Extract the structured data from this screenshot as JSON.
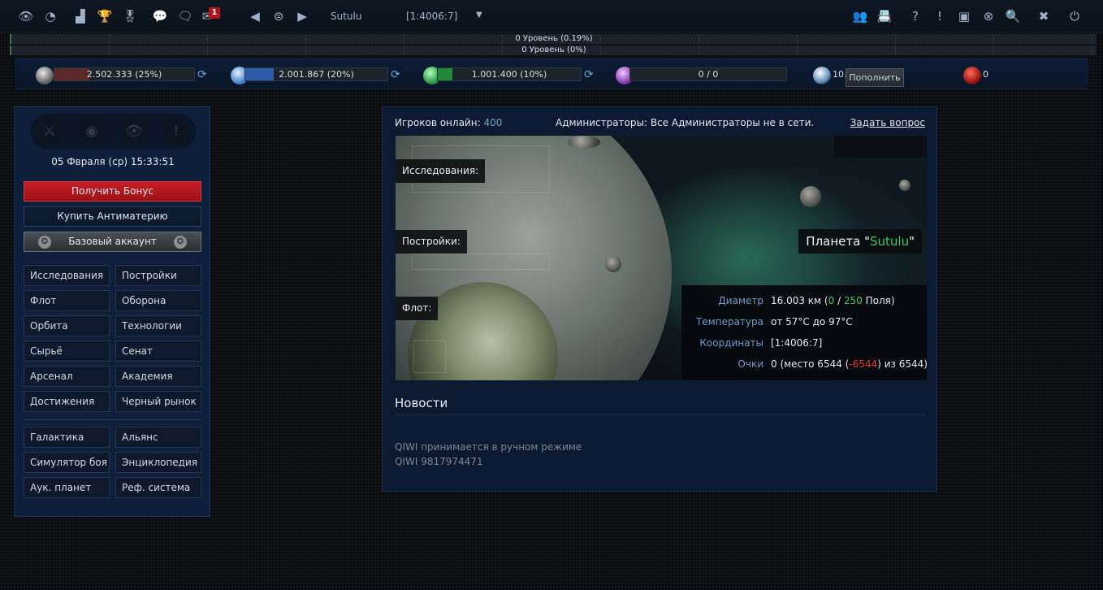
{
  "topbar": {
    "left_icons": [
      "eye-icon",
      "pie-chart-icon",
      "bar-chart-icon",
      "trophy-icon",
      "medal-icon",
      "chat-icon",
      "chats-icon",
      "mail-icon"
    ],
    "mail_badge": "1",
    "planet_name": "Sutulu",
    "coords": "[1:4006:7]",
    "right_icons": [
      "users-icon",
      "contacts-icon",
      "help-icon",
      "info-icon",
      "image-icon",
      "lifebuoy-icon",
      "search-icon",
      "settings-tools-icon",
      "power-icon"
    ]
  },
  "levels": {
    "line1": "0 Уровень (0.19%)",
    "line2": "0 Уровень (0%)"
  },
  "resources": [
    {
      "icon": "metal-icon",
      "label": "2.502.333 (25%)",
      "fill": 0.25,
      "color": "#5a2a2a"
    },
    {
      "icon": "crystal-icon",
      "label": "2.001.867 (20%)",
      "fill": 0.2,
      "color": "#2b5aa8"
    },
    {
      "icon": "deuterium-icon",
      "label": "1.001.400 (10%)",
      "fill": 0.1,
      "color": "#1f8a3a"
    },
    {
      "icon": "energy-icon",
      "label": "0 / 0",
      "fill": 0,
      "color": "#6a2a8a"
    }
  ],
  "antimatter": {
    "value": "10.",
    "topup_label": "Пополнить"
  },
  "darkmatter": {
    "value": "0"
  },
  "sidebar": {
    "datetime": "05 Фвраля (ср) 15:33:51",
    "bonus_label": "Получить Бонус",
    "antimatter_label": "Купить Антиматерию",
    "account_label": "Базовый аккаунт",
    "nav_left": [
      "Исследования",
      "Флот",
      "Орбита",
      "Сырьё",
      "Арсенал",
      "Достижения"
    ],
    "nav_right": [
      "Постройки",
      "Оборона",
      "Технологии",
      "Сенат",
      "Академия",
      "Черный рынок"
    ],
    "nav2_left": [
      "Галактика",
      "Симулятор боя",
      "Аук. планет"
    ],
    "nav2_right": [
      "Альянс",
      "Энциклопедия",
      "Реф. система"
    ]
  },
  "main": {
    "online_label": "Игроков онлайн:",
    "online_count": "400",
    "admins": "Администраторы: Все Администраторы не в сети.",
    "ask": "Задать вопрос",
    "scene_tags": [
      "Исследования:",
      "Постройки:",
      "Флот:"
    ],
    "planet_prefix": "Планета \"",
    "planet_name": "Sutulu",
    "planet_suffix": "\"",
    "info": {
      "diameter_label": "Диаметр",
      "diameter_km": "16.003 км (",
      "fields_used": "0",
      "fields_sep": " / ",
      "fields_max": "250",
      "fields_suffix": " Поля)",
      "temp_label": "Температура",
      "temp_value": "от 57°C до 97°C",
      "coords_label": "Координаты",
      "coords_value": "[1:4006:7]",
      "points_label": "Очки",
      "points_prefix": "0 (место 6544 (",
      "points_delta": "-6544",
      "points_suffix": ") из 6544)"
    },
    "news_title": "Новости",
    "news_lines": [
      "QIWI принимается в ручном режиме",
      "QIWI 9817974471"
    ]
  }
}
